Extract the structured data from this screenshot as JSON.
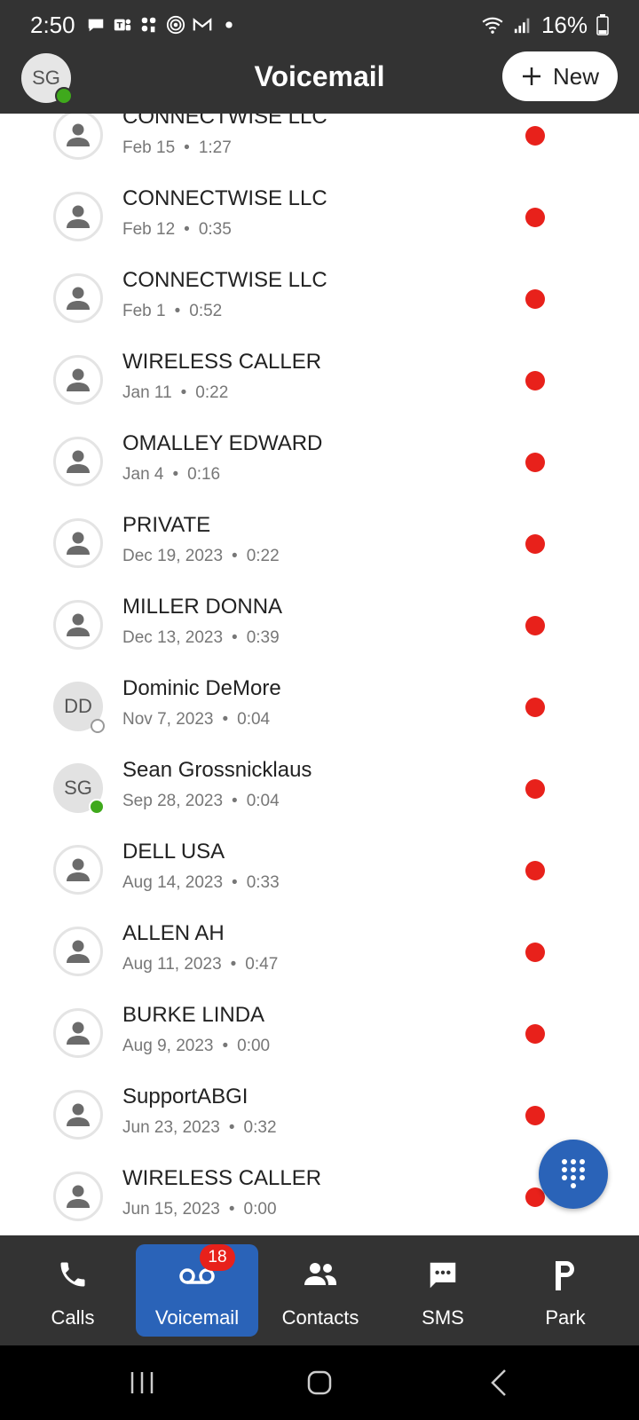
{
  "status_bar": {
    "time": "2:50",
    "battery": "16%",
    "icons": [
      "chat-bubble-icon",
      "teams-icon",
      "slack-icon",
      "target-icon",
      "gmail-icon",
      "dot-icon",
      "wifi-icon",
      "signal-icon",
      "battery-icon"
    ]
  },
  "header": {
    "user_initials": "SG",
    "title": "Voicemail",
    "new_label": "New"
  },
  "voicemails": [
    {
      "name": "CONNECTWISE LLC",
      "date": "Feb 15",
      "duration": "1:27",
      "avatar": "person",
      "unread": true
    },
    {
      "name": "CONNECTWISE LLC",
      "date": "Feb 12",
      "duration": "0:35",
      "avatar": "person",
      "unread": true
    },
    {
      "name": "CONNECTWISE LLC",
      "date": "Feb 1",
      "duration": "0:52",
      "avatar": "person",
      "unread": true
    },
    {
      "name": "WIRELESS CALLER",
      "date": "Jan 11",
      "duration": "0:22",
      "avatar": "person",
      "unread": true
    },
    {
      "name": "OMALLEY EDWARD",
      "date": "Jan 4",
      "duration": "0:16",
      "avatar": "person",
      "unread": true
    },
    {
      "name": "PRIVATE",
      "date": "Dec 19, 2023",
      "duration": "0:22",
      "avatar": "person",
      "unread": true
    },
    {
      "name": "MILLER DONNA",
      "date": "Dec 13, 2023",
      "duration": "0:39",
      "avatar": "person",
      "unread": true
    },
    {
      "name": "Dominic DeMore",
      "date": "Nov 7, 2023",
      "duration": "0:04",
      "avatar": "initials",
      "initials": "DD",
      "presence": "offline",
      "unread": true
    },
    {
      "name": "Sean Grossnicklaus",
      "date": "Sep 28, 2023",
      "duration": "0:04",
      "avatar": "initials",
      "initials": "SG",
      "presence": "online",
      "unread": true
    },
    {
      "name": "DELL USA",
      "date": "Aug 14, 2023",
      "duration": "0:33",
      "avatar": "person",
      "unread": true
    },
    {
      "name": "ALLEN AH",
      "date": "Aug 11, 2023",
      "duration": "0:47",
      "avatar": "person",
      "unread": true
    },
    {
      "name": "BURKE LINDA",
      "date": "Aug 9, 2023",
      "duration": "0:00",
      "avatar": "person",
      "unread": true
    },
    {
      "name": "SupportABGI",
      "date": "Jun 23, 2023",
      "duration": "0:32",
      "avatar": "person",
      "unread": true
    },
    {
      "name": "WIRELESS CALLER",
      "date": "Jun 15, 2023",
      "duration": "0:00",
      "avatar": "person",
      "unread": true
    }
  ],
  "separator": "•",
  "fab": {
    "icon": "dialpad-icon"
  },
  "bottom_nav": {
    "items": [
      {
        "label": "Calls",
        "icon": "phone-icon",
        "active": false
      },
      {
        "label": "Voicemail",
        "icon": "voicemail-icon",
        "active": true,
        "badge": "18"
      },
      {
        "label": "Contacts",
        "icon": "contacts-icon",
        "active": false
      },
      {
        "label": "SMS",
        "icon": "sms-icon",
        "active": false
      },
      {
        "label": "Park",
        "icon": "park-icon",
        "active": false
      }
    ]
  },
  "system_nav": {
    "icons": [
      "recents-icon",
      "home-icon",
      "back-icon"
    ]
  },
  "colors": {
    "bar_background": "#333333",
    "accent": "#2a63b8",
    "unread_dot": "#e8211b",
    "presence_online": "#3fa91c"
  }
}
